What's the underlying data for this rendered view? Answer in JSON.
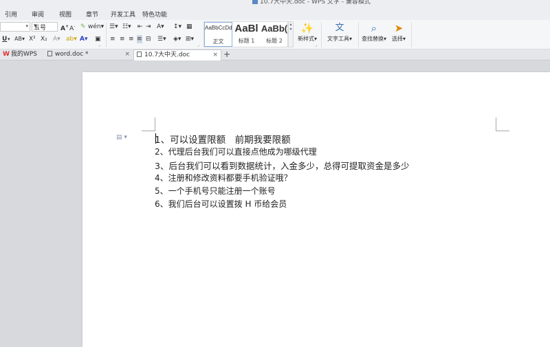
{
  "window": {
    "title": "10.7大中天.doc - WPS 文字 - 兼容模式"
  },
  "menu": [
    "引用",
    "审阅",
    "视图",
    "章节",
    "开发工具",
    "特色功能"
  ],
  "ribbon": {
    "font_size": "五号",
    "styles": [
      {
        "sample": "AaBbCcDd",
        "name": "正文"
      },
      {
        "sample": "AaBl",
        "name": "标题 1"
      },
      {
        "sample": "AaBb(",
        "name": "标题 2"
      }
    ],
    "new_style_label": "新样式",
    "text_tools_label": "文字工具",
    "find_replace_label": "查找替换",
    "select_label": "选择"
  },
  "tabs": [
    {
      "label": "我的WPS"
    },
    {
      "label": "word.doc *"
    },
    {
      "label": "10.7大中天.doc"
    }
  ],
  "document": {
    "lines": [
      "1、可以设置限额　前期我要限额",
      "2、代理后台我们可以直接点他成为哪级代理",
      "3、后台我们可以看到数据统计，入金多少，总得可提取资金是多少",
      "4、注册和修改资料都要手机验证哦？",
      "5、一个手机号只能注册一个账号",
      "6、我们后台可以设置拨 H 币给会员"
    ]
  }
}
